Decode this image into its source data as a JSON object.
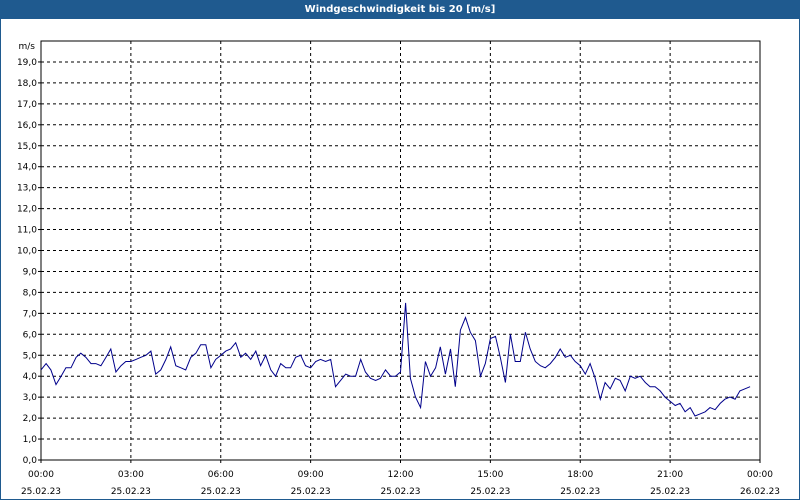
{
  "title": "Windgeschwindigkeit bis 20 [m/s]",
  "chart_data": {
    "type": "line",
    "title": "Windgeschwindigkeit bis 20 [m/s]",
    "ylabel": "m/s",
    "ylim": [
      0,
      20
    ],
    "xlim": [
      0,
      24
    ],
    "grid": true,
    "y_ticks": [
      "0,0",
      "1,0",
      "2,0",
      "3,0",
      "4,0",
      "5,0",
      "6,0",
      "7,0",
      "8,0",
      "9,0",
      "10,0",
      "11,0",
      "12,0",
      "13,0",
      "14,0",
      "15,0",
      "16,0",
      "17,0",
      "18,0",
      "19,0"
    ],
    "x_ticks": [
      {
        "time": "00:00",
        "date": "25.02.23"
      },
      {
        "time": "03:00",
        "date": "25.02.23"
      },
      {
        "time": "06:00",
        "date": "25.02.23"
      },
      {
        "time": "09:00",
        "date": "25.02.23"
      },
      {
        "time": "12:00",
        "date": "25.02.23"
      },
      {
        "time": "15:00",
        "date": "25.02.23"
      },
      {
        "time": "18:00",
        "date": "25.02.23"
      },
      {
        "time": "21:00",
        "date": "25.02.23"
      },
      {
        "time": "00:00",
        "date": "26.02.23"
      }
    ],
    "series": [
      {
        "color": "#00008b",
        "x": [
          0,
          0.17,
          0.33,
          0.5,
          0.67,
          0.83,
          1.0,
          1.17,
          1.33,
          1.5,
          1.67,
          1.83,
          2.0,
          2.17,
          2.33,
          2.5,
          2.67,
          2.83,
          3.0,
          3.17,
          3.33,
          3.5,
          3.67,
          3.83,
          4.0,
          4.17,
          4.33,
          4.5,
          4.67,
          4.83,
          5.0,
          5.17,
          5.33,
          5.5,
          5.67,
          5.83,
          6.0,
          6.17,
          6.33,
          6.5,
          6.67,
          6.83,
          7.0,
          7.17,
          7.33,
          7.5,
          7.67,
          7.83,
          8.0,
          8.17,
          8.33,
          8.5,
          8.67,
          8.83,
          9.0,
          9.17,
          9.33,
          9.5,
          9.67,
          9.83,
          10.0,
          10.17,
          10.33,
          10.5,
          10.67,
          10.83,
          11.0,
          11.17,
          11.33,
          11.5,
          11.67,
          11.83,
          12.0,
          12.17,
          12.33,
          12.5,
          12.67,
          12.83,
          13.0,
          13.17,
          13.33,
          13.5,
          13.67,
          13.83,
          14.0,
          14.17,
          14.33,
          14.5,
          14.67,
          14.83,
          15.0,
          15.17,
          15.33,
          15.5,
          15.67,
          15.83,
          16.0,
          16.17,
          16.33,
          16.5,
          16.67,
          16.83,
          17.0,
          17.17,
          17.33,
          17.5,
          17.67,
          17.83,
          18.0,
          18.17,
          18.33,
          18.5,
          18.67,
          18.83,
          19.0,
          19.17,
          19.33,
          19.5,
          19.67,
          19.83,
          20.0,
          20.17,
          20.33,
          20.5,
          20.67,
          20.83,
          21.0,
          21.17,
          21.33,
          21.5,
          21.67,
          21.83,
          22.0,
          22.17,
          22.33,
          22.5,
          22.67,
          22.83,
          23.0,
          23.17,
          23.33,
          23.5,
          23.67
        ],
        "values": [
          4.3,
          4.6,
          4.3,
          3.6,
          4.0,
          4.4,
          4.4,
          4.9,
          5.1,
          4.9,
          4.6,
          4.6,
          4.5,
          4.9,
          5.3,
          4.2,
          4.5,
          4.7,
          4.7,
          4.8,
          4.9,
          5.0,
          5.2,
          4.1,
          4.3,
          4.8,
          5.4,
          4.5,
          4.4,
          4.3,
          4.9,
          5.1,
          5.5,
          5.5,
          4.4,
          4.8,
          5.0,
          5.2,
          5.3,
          5.6,
          4.9,
          5.1,
          4.8,
          5.2,
          4.5,
          5.0,
          4.3,
          4.0,
          4.6,
          4.4,
          4.4,
          4.9,
          5.0,
          4.5,
          4.4,
          4.7,
          4.8,
          4.7,
          4.8,
          3.5,
          3.8,
          4.1,
          4.0,
          4.0,
          4.8,
          4.2,
          3.9,
          3.8,
          3.9,
          4.3,
          4.0,
          4.0,
          4.2,
          7.5,
          3.9,
          3.0,
          2.5,
          4.7,
          4.0,
          4.4,
          5.4,
          4.1,
          5.3,
          3.5,
          6.2,
          6.8,
          6.1,
          5.7,
          4.0,
          4.6,
          5.8,
          5.9,
          4.9,
          3.7,
          6.0,
          4.7,
          4.7,
          6.1,
          5.3,
          4.7,
          4.5,
          4.4,
          4.6,
          4.9,
          5.3,
          4.9,
          5.0,
          4.7,
          4.5,
          4.1,
          4.6,
          3.9,
          2.9,
          3.7,
          3.4,
          3.9,
          3.8,
          3.3,
          4.0,
          3.9,
          4.0,
          3.7,
          3.5,
          3.5,
          3.3,
          3.0,
          2.8,
          2.6,
          2.7,
          2.3,
          2.5,
          2.1,
          2.2,
          2.3,
          2.5,
          2.4,
          2.7,
          2.9,
          3.0,
          2.9,
          3.3,
          3.4,
          3.5
        ]
      }
    ]
  }
}
